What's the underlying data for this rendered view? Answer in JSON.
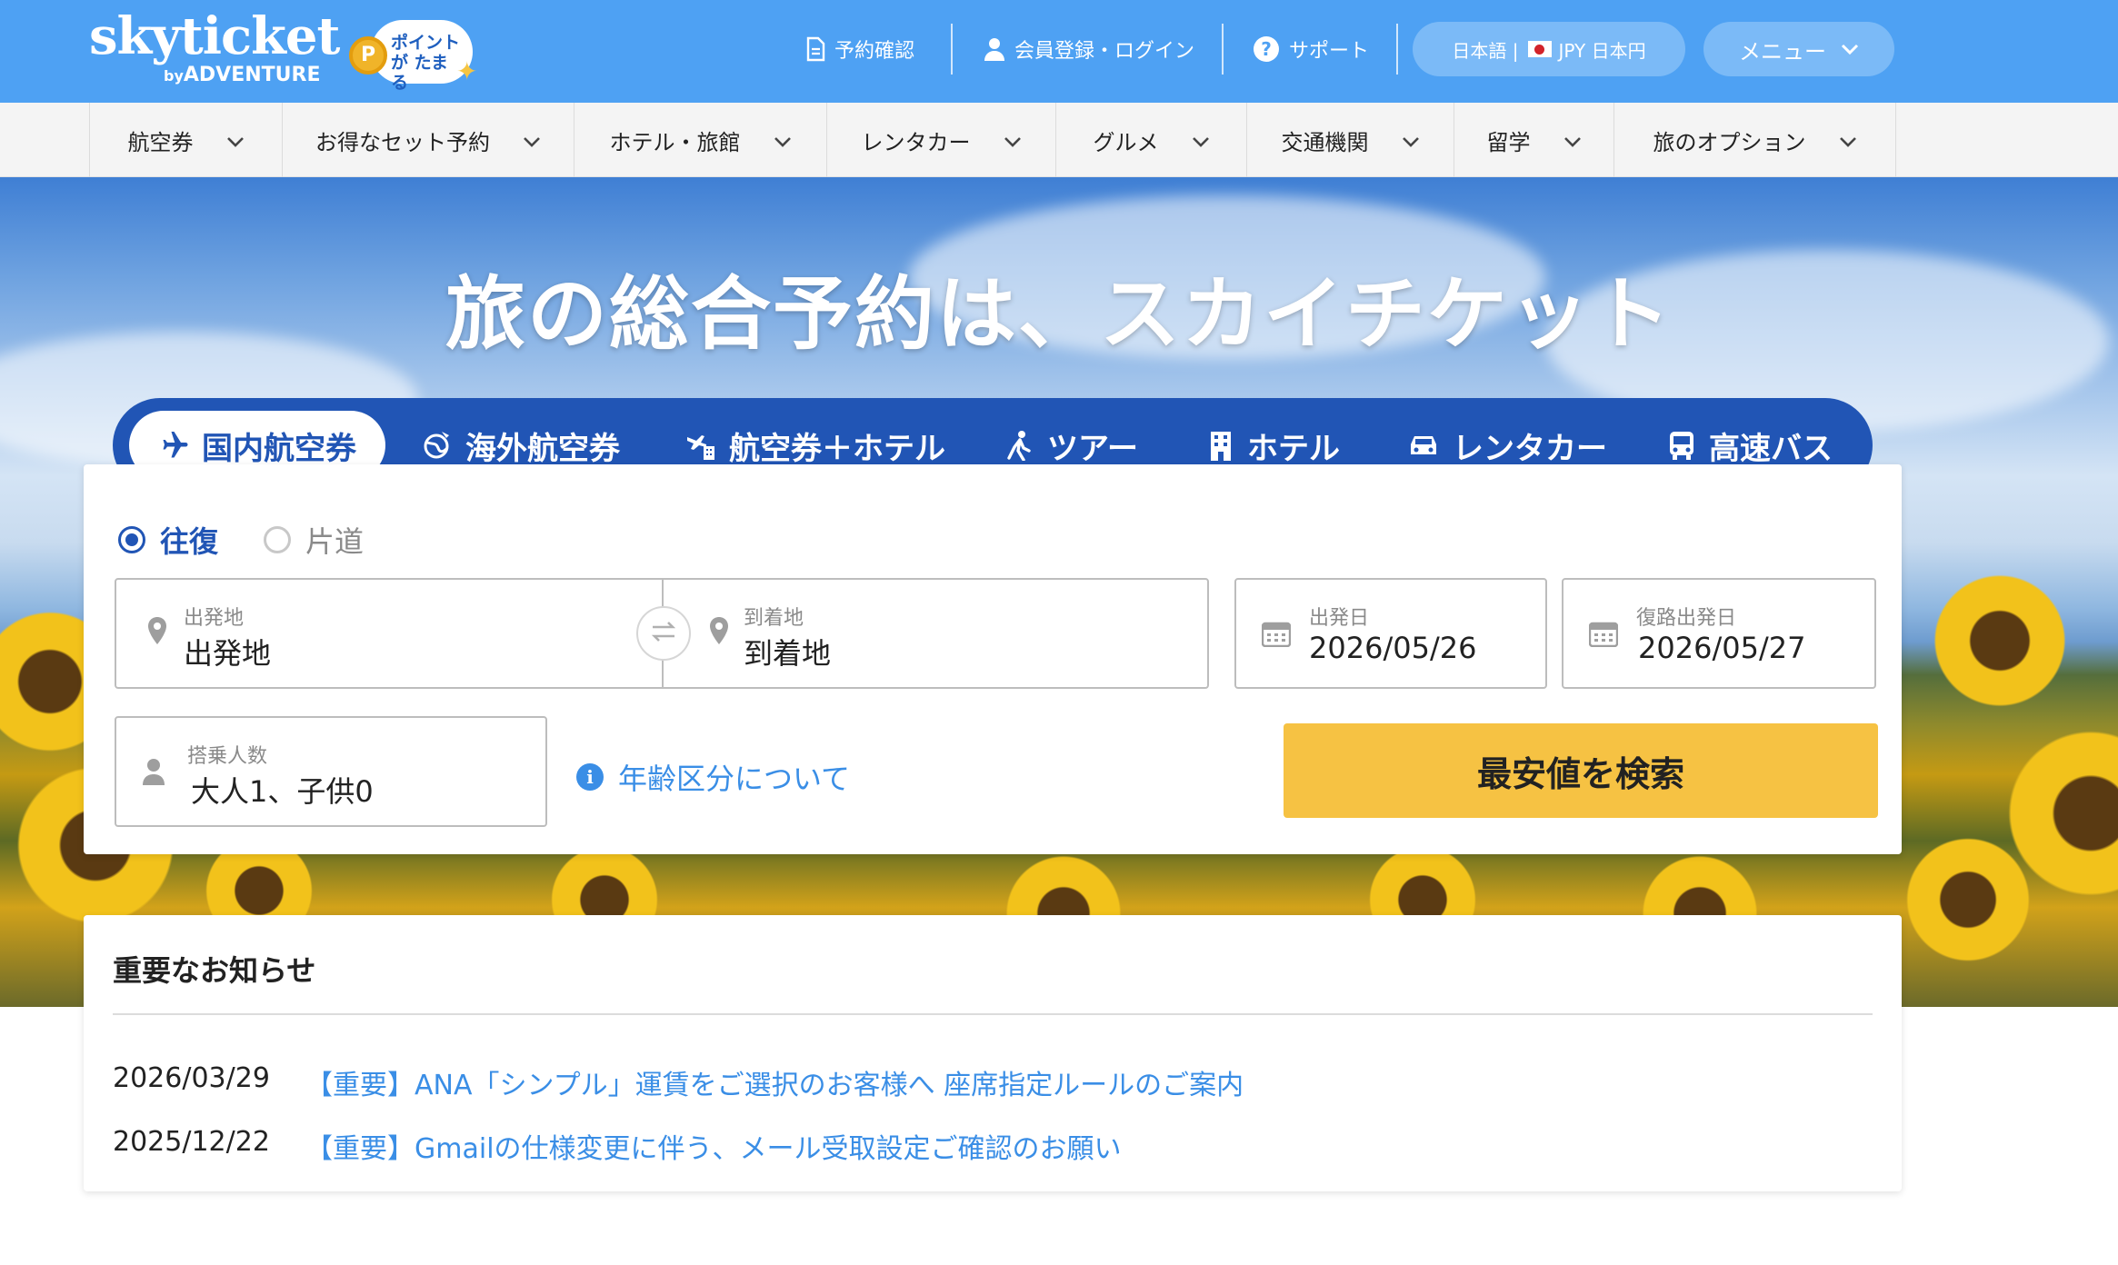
{
  "header": {
    "logo_main": "skyticket",
    "logo_by": "by",
    "logo_sub": "ADVENTURE",
    "points_badge": "ポイントが たまる",
    "points_coin": "P",
    "links": {
      "reservation_check": "予約確認",
      "register_login": "会員登録・ログイン",
      "support": "サポート"
    },
    "language_currency": {
      "language": "日本語 |",
      "currency": "JPY 日本円"
    },
    "menu_label": "メニュー"
  },
  "category_nav": [
    {
      "label": "航空券"
    },
    {
      "label": "お得なセット予約"
    },
    {
      "label": "ホテル・旅館"
    },
    {
      "label": "レンタカー"
    },
    {
      "label": "グルメ"
    },
    {
      "label": "交通機関"
    },
    {
      "label": "留学"
    },
    {
      "label": "旅のオプション"
    }
  ],
  "hero": {
    "headline": "旅の総合予約は、スカイチケット"
  },
  "search_tabs": [
    {
      "label": "国内航空券",
      "icon": "airplane-icon",
      "active": true
    },
    {
      "label": "海外航空券",
      "icon": "globe-plane-icon",
      "active": false
    },
    {
      "label": "航空券＋ホテル",
      "icon": "plane-hotel-icon",
      "active": false
    },
    {
      "label": "ツアー",
      "icon": "walker-icon",
      "active": false
    },
    {
      "label": "ホテル",
      "icon": "building-icon",
      "active": false
    },
    {
      "label": "レンタカー",
      "icon": "car-icon",
      "active": false
    },
    {
      "label": "高速バス",
      "icon": "bus-icon",
      "active": false
    }
  ],
  "search": {
    "trip_type": {
      "round_trip": "往復",
      "one_way": "片道",
      "selected": "往復"
    },
    "departure": {
      "label": "出発地",
      "value": "出発地"
    },
    "arrival": {
      "label": "到着地",
      "value": "到着地"
    },
    "depart_date": {
      "label": "出発日",
      "value": "2026/05/26"
    },
    "return_date": {
      "label": "復路出発日",
      "value": "2026/05/27"
    },
    "passengers": {
      "label": "搭乗人数",
      "value": "大人1、子供0"
    },
    "age_info_link": "年齢区分について",
    "search_button": "最安値を検索"
  },
  "notices": {
    "title": "重要なお知らせ",
    "items": [
      {
        "date": "2026/03/29",
        "text": "【重要】ANA「シンプル」運賃をご選択のお客様へ 座席指定ルールのご案内"
      },
      {
        "date": "2025/12/22",
        "text": "【重要】Gmailの仕様変更に伴う、メール受取設定ご確認のお願い"
      }
    ]
  },
  "colors": {
    "header_blue": "#4ea1f3",
    "tab_navy": "#2155b5",
    "search_button": "#f6c243",
    "link_blue": "#3a8ee6"
  }
}
